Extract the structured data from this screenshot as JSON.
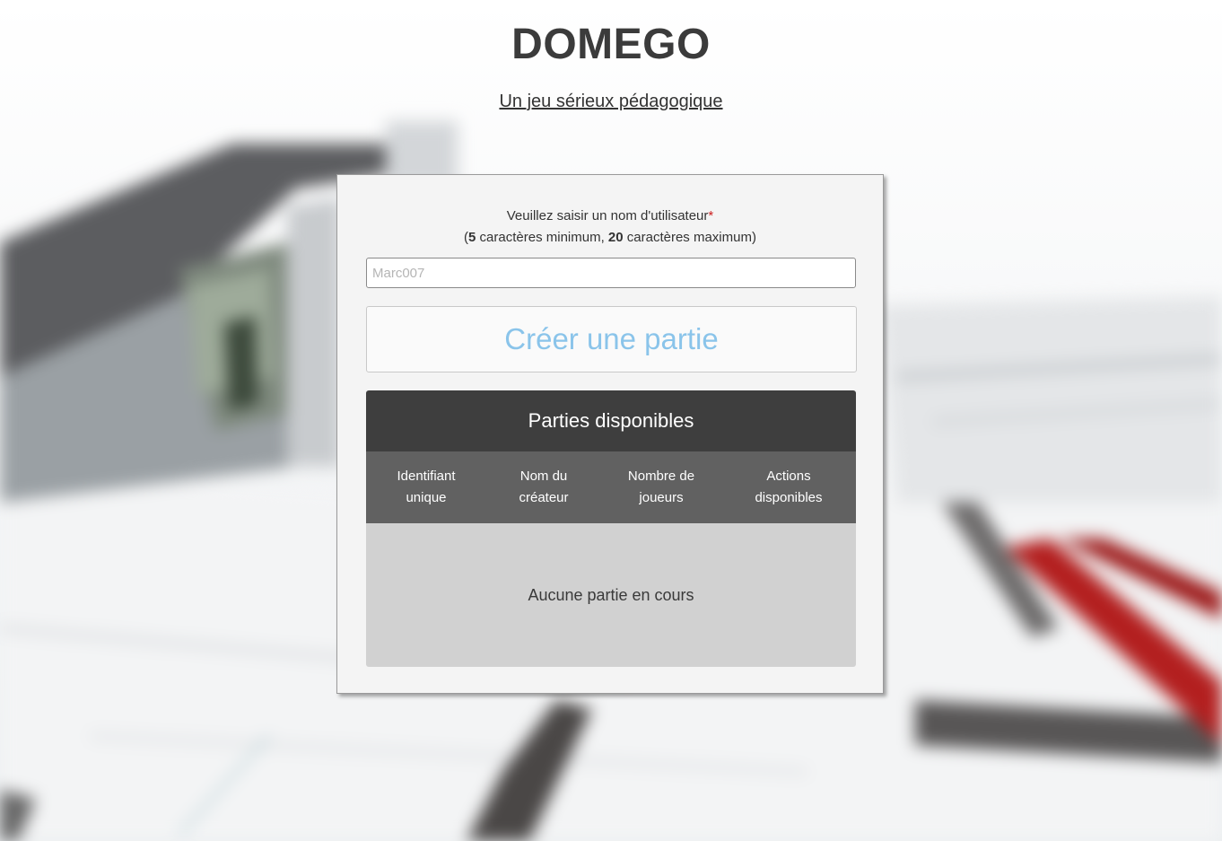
{
  "header": {
    "title": "DOMEGO",
    "subtitle": "Un jeu sérieux pédagogique"
  },
  "form": {
    "prompt_line1": "Veuillez saisir un nom d'utilisateur",
    "required_mark": "*",
    "prompt_line2_open": "(",
    "min_chars": "5",
    "prompt_line2_mid": " caractères minimum, ",
    "max_chars": "20",
    "prompt_line2_end": " caractères maximum)",
    "username_placeholder": "Marc007",
    "username_value": "",
    "create_button_label": "Créer une partie"
  },
  "games_table": {
    "title": "Parties disponibles",
    "columns": [
      "Identifiant\nunique",
      "Nom du\ncréateur",
      "Nombre de\njoueurs",
      "Actions\ndisponibles"
    ],
    "rows": [],
    "empty_message": "Aucune partie en cours"
  },
  "colors": {
    "title_text": "#3b3b3b",
    "panel_background": "#f4f4f4",
    "button_text": "#8ac4ea",
    "table_title_background": "#3e3e3e",
    "table_header_background": "#616161",
    "table_body_background": "#d1d1d1",
    "required_mark": "#cc1f1f"
  }
}
